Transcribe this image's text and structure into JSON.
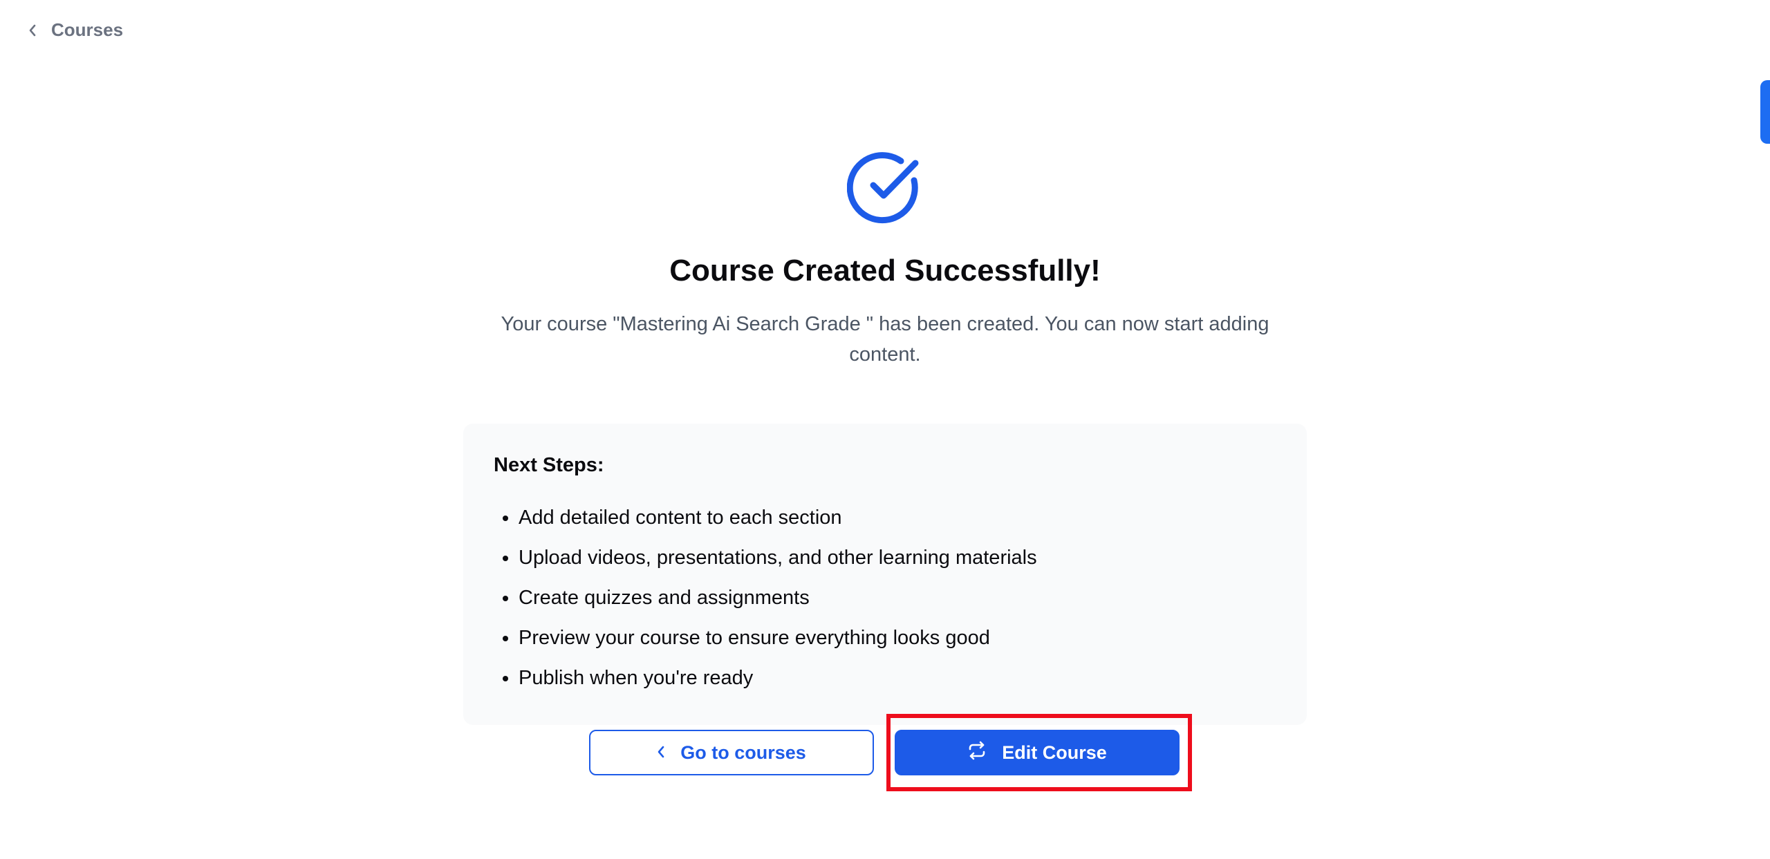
{
  "nav": {
    "back_label": "Courses"
  },
  "success": {
    "icon": "check-circle-icon",
    "title": "Course Created Successfully!",
    "message": "Your course \"Mastering Ai Search Grade \" has been created. You can now start adding content."
  },
  "next_steps": {
    "title": "Next Steps:",
    "items": [
      "Add detailed content to each section",
      "Upload videos, presentations, and other learning materials",
      "Create quizzes and assignments",
      "Preview your course to ensure everything looks good",
      "Publish when you're ready"
    ]
  },
  "actions": {
    "go_to_courses_label": "Go to courses",
    "edit_course_label": "Edit Course"
  },
  "colors": {
    "accent": "#1d5be8",
    "highlight": "#ee0d1c",
    "muted_text": "#4b5563",
    "card_bg": "#f9fafb"
  }
}
